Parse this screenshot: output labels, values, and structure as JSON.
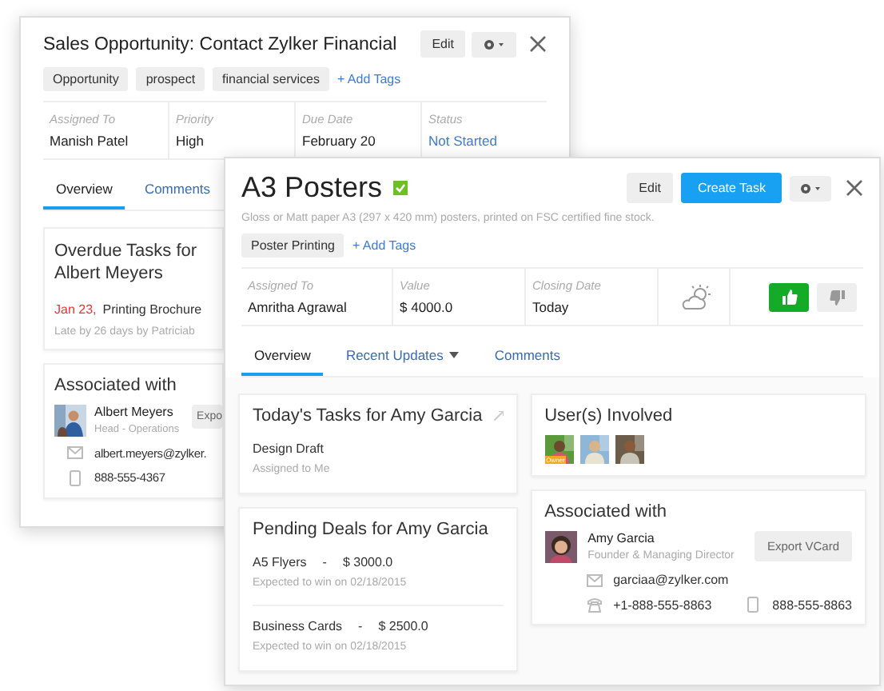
{
  "back_window": {
    "title": "Sales Opportunity: Contact Zylker Financial",
    "edit_button": "Edit",
    "tags": [
      "Opportunity",
      "prospect",
      "financial services"
    ],
    "add_tags": "+ Add Tags",
    "fields": [
      {
        "label": "Assigned To",
        "value": "Manish Patel",
        "link": false
      },
      {
        "label": "Priority",
        "value": "High",
        "link": false
      },
      {
        "label": "Due Date",
        "value": "February 20",
        "link": false
      },
      {
        "label": "Status",
        "value": "Not Started",
        "link": true
      }
    ],
    "tabs": [
      {
        "label": "Overview",
        "selected": true
      },
      {
        "label": "Comments",
        "selected": false
      }
    ],
    "overdue": {
      "title": "Overdue Tasks for Albert Meyers",
      "date": "Jan 23,",
      "task": "Printing Brochure",
      "note": "Late by 26 days by Patriciab"
    },
    "associated": {
      "title": "Associated with",
      "name": "Albert Meyers",
      "role": "Head - Operations",
      "export_button": "Expo",
      "email": "albert.meyers@zylker.",
      "mobile": "888-555-4367"
    }
  },
  "front_window": {
    "title": "A3 Posters",
    "verified": true,
    "buttons": [
      {
        "label": "Edit",
        "kind": "plain"
      },
      {
        "label": "Create Task",
        "kind": "primary"
      }
    ],
    "description": "Gloss or Matt paper A3 (297 x 420 mm) posters, printed on FSC certified fine stock.",
    "tags": [
      "Poster Printing"
    ],
    "add_tags": "+ Add Tags",
    "fields": [
      {
        "label": "Assigned To",
        "value": "Amritha Agrawal"
      },
      {
        "label": "Value",
        "value": "$ 4000.0"
      },
      {
        "label": "Closing Date",
        "value": "Today"
      }
    ],
    "vote": {
      "liked": true
    },
    "tabs": [
      {
        "label": "Overview",
        "selected": true,
        "menu": false
      },
      {
        "label": "Recent Updates",
        "selected": false,
        "menu": true
      },
      {
        "label": "Comments",
        "selected": false,
        "menu": false
      }
    ],
    "todays_tasks": {
      "title": "Today's Tasks for Amy Garcia",
      "items": [
        {
          "name": "Design Draft",
          "note": "Assigned to Me"
        }
      ]
    },
    "pending_deals": {
      "title": "Pending Deals for Amy Garcia",
      "items": [
        {
          "name": "A5 Flyers",
          "separator": "-",
          "amount": "$ 3000.0",
          "note": "Expected to win on 02/18/2015"
        },
        {
          "name": "Business Cards",
          "separator": "-",
          "amount": "$ 2500.0",
          "note": "Expected to win on 02/18/2015"
        }
      ]
    },
    "users": {
      "title": "User(s) Involved",
      "owner_badge": "Owner",
      "avatars": [
        {
          "owner": true
        },
        {
          "owner": false
        },
        {
          "owner": false
        }
      ]
    },
    "associated": {
      "title": "Associated with",
      "name": "Amy Garcia",
      "role": "Founder & Managing Director",
      "export_button": "Export VCard",
      "email": "garciaa@zylker.com",
      "phone": "+1-888-555-8863",
      "mobile": "888-555-8863"
    }
  }
}
